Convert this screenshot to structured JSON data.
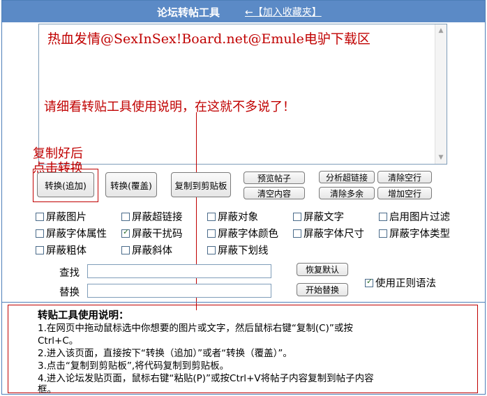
{
  "header": {
    "title": "论坛转帖工具",
    "favorite_link": "←【加入收藏夹】"
  },
  "editor": {
    "content_line1": "热血发情@SexInSex!Board.net@Emule电驴下载区",
    "note": "请细看转贴工具使用说明，在这就不多说了！"
  },
  "annotation": {
    "line1": "复制好后",
    "line2": "点击转换"
  },
  "buttons": {
    "convert_append": "转换(追加)",
    "convert_overwrite": "转换(覆盖)",
    "copy_clipboard": "复制到剪贴板",
    "preview": "预览帖子",
    "clear_content": "清空内容",
    "analyze_links": "分析超链接",
    "clear_blank_lines": "清除空行",
    "clear_extra_spaces": "清除多余",
    "add_blank_lines": "增加空行",
    "restore_default": "恢复默认",
    "start_replace": "开始替换"
  },
  "options": [
    {
      "label": "屏蔽图片",
      "checked": false
    },
    {
      "label": "屏蔽超链接",
      "checked": false
    },
    {
      "label": "屏蔽对象",
      "checked": false
    },
    {
      "label": "屏蔽文字",
      "checked": false
    },
    {
      "label": "启用图片过滤",
      "checked": false
    },
    {
      "label": "屏蔽字体属性",
      "checked": false
    },
    {
      "label": "屏蔽干扰码",
      "checked": true
    },
    {
      "label": "屏蔽字体颜色",
      "checked": false
    },
    {
      "label": "屏蔽字体尺寸",
      "checked": false
    },
    {
      "label": "屏蔽字体类型",
      "checked": false
    },
    {
      "label": "屏蔽粗体",
      "checked": false
    },
    {
      "label": "屏蔽斜体",
      "checked": false
    },
    {
      "label": "屏蔽下划线",
      "checked": false
    }
  ],
  "find_replace": {
    "find_label": "查找",
    "replace_label": "替换",
    "find_value": "",
    "replace_value": "",
    "use_regex_label": "使用正则语法",
    "use_regex_checked": true
  },
  "help": {
    "heading": "转贴工具使用说明：",
    "lines": [
      "1.在网页中拖动鼠标选中你想要的图片或文字，然后鼠标右键“复制(C)”或按",
      "Ctrl+C。",
      "2.进入该页面，直接按下“转换（追加）”或者“转换（覆盖）”。",
      "3.点击“复制到剪贴板”,将代码复制到剪贴板。",
      "4.进入论坛发贴页面，鼠标右键“粘贴(P)”或按Ctrl+V将帖子内容复制到帖子内容",
      "框。"
    ]
  },
  "colors": {
    "accent": "#5b8ac6",
    "annotation": "#c00000"
  }
}
